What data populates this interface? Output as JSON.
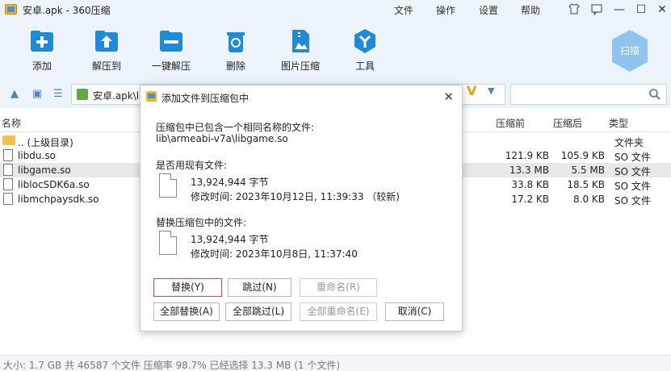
{
  "window": {
    "title": "安卓.apk - 360压缩"
  },
  "menu": [
    "文件",
    "操作",
    "设置",
    "帮助"
  ],
  "toolbar": {
    "add": "添加",
    "extract_to": "解压到",
    "one_click_extract": "一键解压",
    "delete": "删除",
    "image_compress": "图片压缩",
    "tools": "工具",
    "scan": "扫描"
  },
  "address": {
    "path": "安卓.apk\\l"
  },
  "columns": {
    "name": "名称",
    "packed": "压缩前",
    "compressed": "压缩后",
    "type": "类型"
  },
  "files": [
    {
      "name": ".. (上级目录)",
      "packed": "",
      "compressed": "",
      "type": "文件夹"
    },
    {
      "name": "libdu.so",
      "packed": "121.9 KB",
      "compressed": "105.9 KB",
      "type": "SO 文件"
    },
    {
      "name": "libgame.so",
      "packed": "13.3 MB",
      "compressed": "5.5 MB",
      "type": "SO 文件"
    },
    {
      "name": "liblocSDK6a.so",
      "packed": "33.8 KB",
      "compressed": "18.5 KB",
      "type": "SO 文件"
    },
    {
      "name": "libmchpaysdk.so",
      "packed": "17.2 KB",
      "compressed": "8.0 KB",
      "type": "SO 文件"
    }
  ],
  "status": "大小: 1.7 GB 共 46587 个文件 压缩率 98.7% 已经选择 13.3 MB (1 个文件)",
  "dialog": {
    "title": "添加文件到压缩包中",
    "conflict_msg": "压缩包中已包含一个相同名称的文件:",
    "conflict_path": "lib\\armeabi-v7a\\libgame.so",
    "use_existing": "是否用现有文件:",
    "existing_size": "13,924,944 字节",
    "existing_time": "修改时间: 2023年10月12日, 11:39:33 （较新)",
    "replace_in": "替换压缩包中的文件:",
    "archive_size": "13,924,944 字节",
    "archive_time": "修改时间: 2023年10月8日, 11:37:40",
    "buttons": {
      "replace": "替换(Y)",
      "skip": "跳过(N)",
      "rename": "重命名(R)",
      "replace_all": "全部替换(A)",
      "skip_all": "全部跳过(L)",
      "rename_all": "全部重命名(E)",
      "cancel": "取消(C)"
    }
  }
}
